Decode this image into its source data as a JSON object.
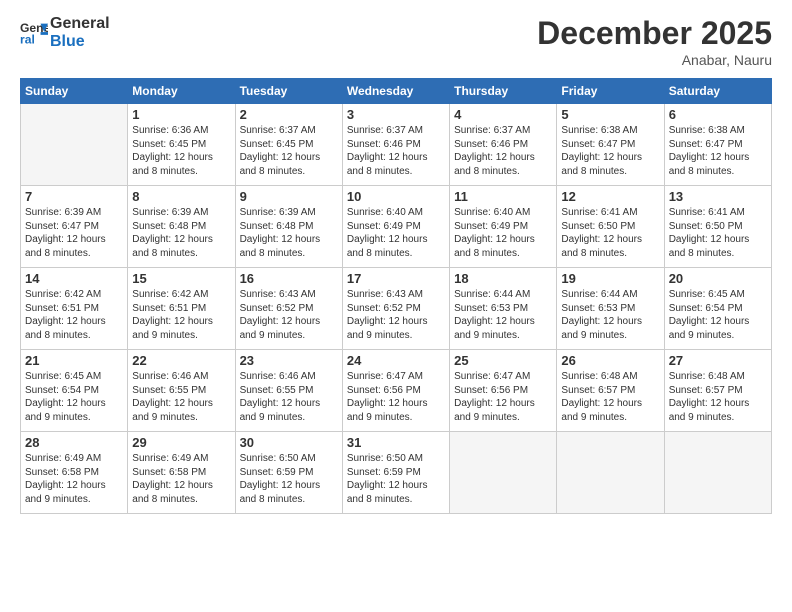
{
  "header": {
    "logo_line1": "General",
    "logo_line2": "Blue",
    "month": "December 2025",
    "location": "Anabar, Nauru"
  },
  "weekdays": [
    "Sunday",
    "Monday",
    "Tuesday",
    "Wednesday",
    "Thursday",
    "Friday",
    "Saturday"
  ],
  "weeks": [
    [
      {
        "day": "",
        "info": ""
      },
      {
        "day": "1",
        "info": "Sunrise: 6:36 AM\nSunset: 6:45 PM\nDaylight: 12 hours\nand 8 minutes."
      },
      {
        "day": "2",
        "info": "Sunrise: 6:37 AM\nSunset: 6:45 PM\nDaylight: 12 hours\nand 8 minutes."
      },
      {
        "day": "3",
        "info": "Sunrise: 6:37 AM\nSunset: 6:46 PM\nDaylight: 12 hours\nand 8 minutes."
      },
      {
        "day": "4",
        "info": "Sunrise: 6:37 AM\nSunset: 6:46 PM\nDaylight: 12 hours\nand 8 minutes."
      },
      {
        "day": "5",
        "info": "Sunrise: 6:38 AM\nSunset: 6:47 PM\nDaylight: 12 hours\nand 8 minutes."
      },
      {
        "day": "6",
        "info": "Sunrise: 6:38 AM\nSunset: 6:47 PM\nDaylight: 12 hours\nand 8 minutes."
      }
    ],
    [
      {
        "day": "7",
        "info": "Sunrise: 6:39 AM\nSunset: 6:47 PM\nDaylight: 12 hours\nand 8 minutes."
      },
      {
        "day": "8",
        "info": "Sunrise: 6:39 AM\nSunset: 6:48 PM\nDaylight: 12 hours\nand 8 minutes."
      },
      {
        "day": "9",
        "info": "Sunrise: 6:39 AM\nSunset: 6:48 PM\nDaylight: 12 hours\nand 8 minutes."
      },
      {
        "day": "10",
        "info": "Sunrise: 6:40 AM\nSunset: 6:49 PM\nDaylight: 12 hours\nand 8 minutes."
      },
      {
        "day": "11",
        "info": "Sunrise: 6:40 AM\nSunset: 6:49 PM\nDaylight: 12 hours\nand 8 minutes."
      },
      {
        "day": "12",
        "info": "Sunrise: 6:41 AM\nSunset: 6:50 PM\nDaylight: 12 hours\nand 8 minutes."
      },
      {
        "day": "13",
        "info": "Sunrise: 6:41 AM\nSunset: 6:50 PM\nDaylight: 12 hours\nand 8 minutes."
      }
    ],
    [
      {
        "day": "14",
        "info": "Sunrise: 6:42 AM\nSunset: 6:51 PM\nDaylight: 12 hours\nand 8 minutes."
      },
      {
        "day": "15",
        "info": "Sunrise: 6:42 AM\nSunset: 6:51 PM\nDaylight: 12 hours\nand 9 minutes."
      },
      {
        "day": "16",
        "info": "Sunrise: 6:43 AM\nSunset: 6:52 PM\nDaylight: 12 hours\nand 9 minutes."
      },
      {
        "day": "17",
        "info": "Sunrise: 6:43 AM\nSunset: 6:52 PM\nDaylight: 12 hours\nand 9 minutes."
      },
      {
        "day": "18",
        "info": "Sunrise: 6:44 AM\nSunset: 6:53 PM\nDaylight: 12 hours\nand 9 minutes."
      },
      {
        "day": "19",
        "info": "Sunrise: 6:44 AM\nSunset: 6:53 PM\nDaylight: 12 hours\nand 9 minutes."
      },
      {
        "day": "20",
        "info": "Sunrise: 6:45 AM\nSunset: 6:54 PM\nDaylight: 12 hours\nand 9 minutes."
      }
    ],
    [
      {
        "day": "21",
        "info": "Sunrise: 6:45 AM\nSunset: 6:54 PM\nDaylight: 12 hours\nand 9 minutes."
      },
      {
        "day": "22",
        "info": "Sunrise: 6:46 AM\nSunset: 6:55 PM\nDaylight: 12 hours\nand 9 minutes."
      },
      {
        "day": "23",
        "info": "Sunrise: 6:46 AM\nSunset: 6:55 PM\nDaylight: 12 hours\nand 9 minutes."
      },
      {
        "day": "24",
        "info": "Sunrise: 6:47 AM\nSunset: 6:56 PM\nDaylight: 12 hours\nand 9 minutes."
      },
      {
        "day": "25",
        "info": "Sunrise: 6:47 AM\nSunset: 6:56 PM\nDaylight: 12 hours\nand 9 minutes."
      },
      {
        "day": "26",
        "info": "Sunrise: 6:48 AM\nSunset: 6:57 PM\nDaylight: 12 hours\nand 9 minutes."
      },
      {
        "day": "27",
        "info": "Sunrise: 6:48 AM\nSunset: 6:57 PM\nDaylight: 12 hours\nand 9 minutes."
      }
    ],
    [
      {
        "day": "28",
        "info": "Sunrise: 6:49 AM\nSunset: 6:58 PM\nDaylight: 12 hours\nand 9 minutes."
      },
      {
        "day": "29",
        "info": "Sunrise: 6:49 AM\nSunset: 6:58 PM\nDaylight: 12 hours\nand 8 minutes."
      },
      {
        "day": "30",
        "info": "Sunrise: 6:50 AM\nSunset: 6:59 PM\nDaylight: 12 hours\nand 8 minutes."
      },
      {
        "day": "31",
        "info": "Sunrise: 6:50 AM\nSunset: 6:59 PM\nDaylight: 12 hours\nand 8 minutes."
      },
      {
        "day": "",
        "info": ""
      },
      {
        "day": "",
        "info": ""
      },
      {
        "day": "",
        "info": ""
      }
    ]
  ]
}
